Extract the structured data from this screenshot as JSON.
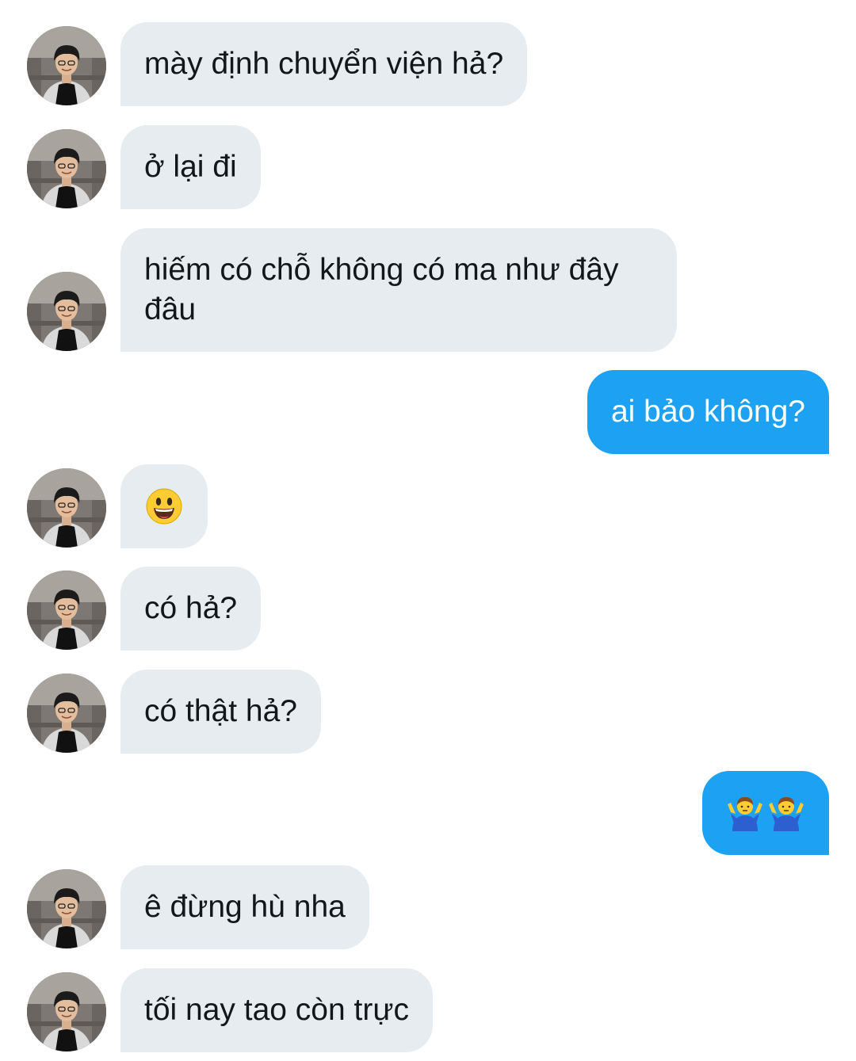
{
  "messages": [
    {
      "side": "in",
      "text": "mày định chuyển viện hả?"
    },
    {
      "side": "in",
      "text": "ở lại đi"
    },
    {
      "side": "in",
      "text": "hiếm có chỗ không có ma như đây đâu"
    },
    {
      "side": "out",
      "text": "ai bảo không?"
    },
    {
      "side": "in",
      "emoji": "grinning-face-emoji"
    },
    {
      "side": "in",
      "text": "có hả?"
    },
    {
      "side": "in",
      "text": "có thật hả?"
    },
    {
      "side": "out",
      "emoji": "shrugging-man-emoji-pair"
    },
    {
      "side": "in",
      "text": "ê đừng hù nha"
    },
    {
      "side": "in",
      "text": "tối nay tao còn trực"
    }
  ],
  "colors": {
    "incoming_bubble": "#e6ecf0",
    "outgoing_bubble": "#1da1f2",
    "incoming_text": "#14171a",
    "outgoing_text": "#ffffff"
  }
}
